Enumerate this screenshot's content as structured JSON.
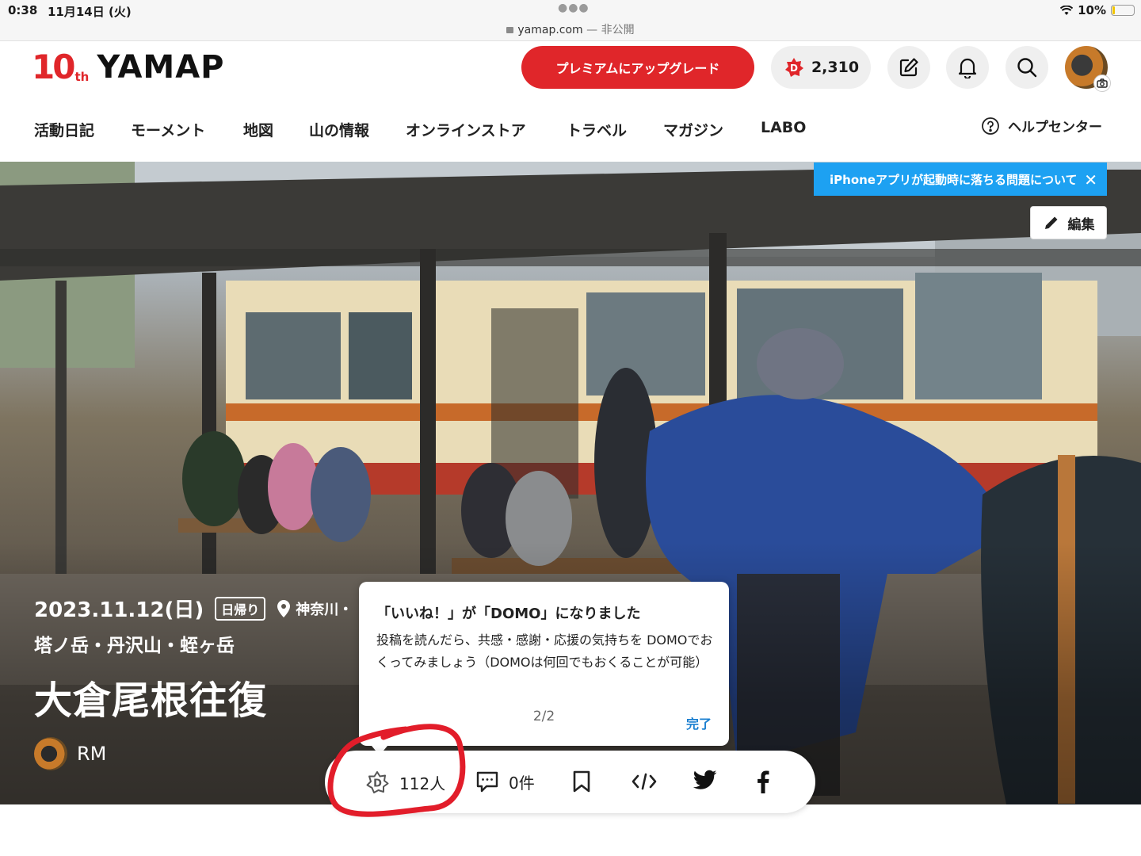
{
  "status_bar": {
    "time": "0:38",
    "date": "11月14日 (火)",
    "url": "yamap.com",
    "url_suffix": " — 非公開",
    "battery": "10%",
    "battery_level": 0.1
  },
  "header": {
    "logo_ten": "10",
    "logo_th": "th",
    "logo_name": "YAMAP",
    "premium_label": "プレミアムにアップグレード",
    "domo_count": "2,310",
    "brand_color": "#e0262a"
  },
  "nav": {
    "items": [
      "活動日記",
      "モーメント",
      "地図",
      "山の情報",
      "オンラインストア",
      "トラベル",
      "マガジン",
      "LABO"
    ],
    "help_label": "ヘルプセンター"
  },
  "notice": {
    "text": "iPhoneアプリが起動時に落ちる問題について",
    "color": "#1da1f2"
  },
  "edit_label": "編集",
  "activity": {
    "date": "2023.11.12(日)",
    "day_type": "日帰り",
    "location": "神奈川・",
    "mountains": "塔ノ岳・丹沢山・蛭ヶ岳",
    "title": "大倉尾根往復",
    "user_name": "RM"
  },
  "tooltip": {
    "heading": "「いいね！」が「DOMO」になりました",
    "body": "投稿を読んだら、共感・感謝・応援の気持ちを DOMOでおくってみましょう（DOMOは何回でもおくることが可能）",
    "page": "2/2",
    "done_label": "完了"
  },
  "action_bar": {
    "domo_count": "112人",
    "comment_count": "0件"
  },
  "icons": [
    "lock-icon",
    "wifi-icon",
    "battery-icon",
    "domo-icon",
    "edit-note-icon",
    "bell-icon",
    "search-icon",
    "camera-icon",
    "help-icon",
    "close-icon",
    "pencil-icon",
    "location-pin-icon",
    "comment-icon",
    "bookmark-icon",
    "embed-code-icon",
    "twitter-icon",
    "facebook-icon"
  ]
}
